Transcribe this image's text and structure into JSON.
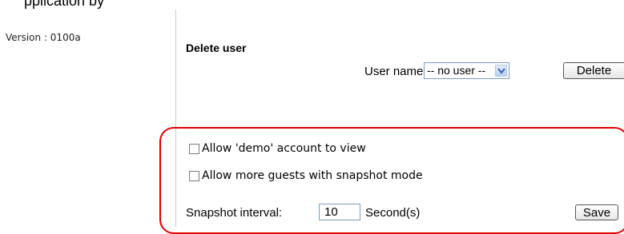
{
  "header": {
    "cut_text": "pplication by"
  },
  "sidebar": {
    "version_text": "Version : 0100a"
  },
  "delete_user": {
    "title": "Delete user",
    "username_label": "User name",
    "selected_user": "-- no user --",
    "delete_label": "Delete"
  },
  "guest_settings": {
    "allow_demo_label": "Allow 'demo' account to view",
    "allow_demo_checked": false,
    "allow_guests_label": "Allow more guests with snapshot mode",
    "allow_guests_checked": false,
    "interval_label": "Snapshot interval:",
    "interval_value": "10",
    "interval_unit": "Second(s)",
    "save_label": "Save"
  },
  "colors": {
    "highlight": "#e00000",
    "input_border": "#7f9db9"
  }
}
